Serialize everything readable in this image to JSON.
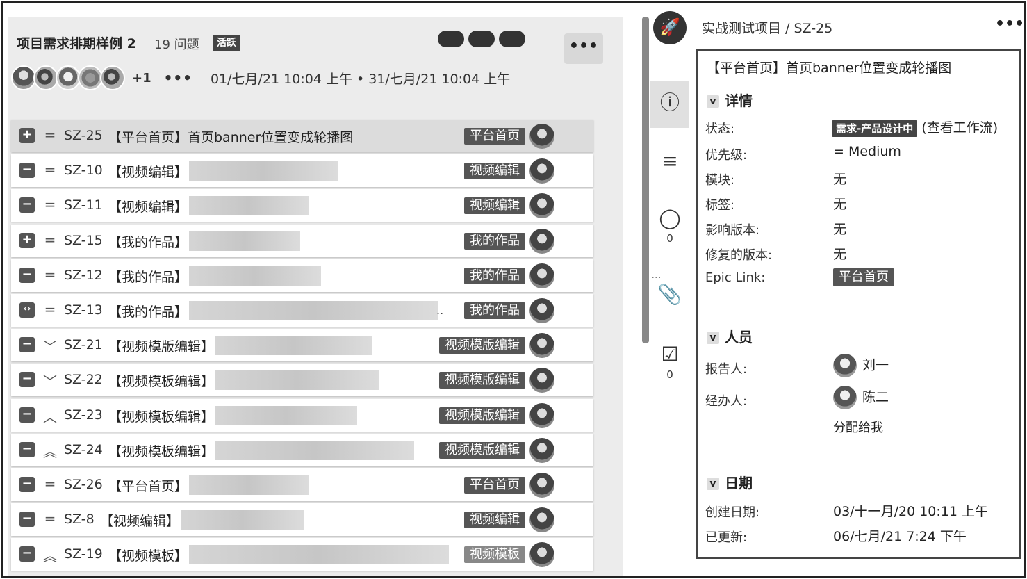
{
  "board": {
    "sprint_title": "项目需求排期样例 2",
    "issue_count": "19 问题",
    "active_label": "活跃",
    "more": "•••",
    "plus_more": "+1",
    "dots": "•••",
    "date_range": "01/七月/21 10:04 上午 • 31/七月/21 10:04 上午"
  },
  "issues": [
    {
      "key": "SZ-25",
      "type": "+",
      "priority": "=",
      "summary": "【平台首页】首页banner位置变成轮播图",
      "epic": "平台首页",
      "blur_w": 0,
      "selected": true
    },
    {
      "key": "SZ-10",
      "type": "−",
      "priority": "=",
      "summary": "【视频编辑】",
      "epic": "视频编辑",
      "blur_w": 214
    },
    {
      "key": "SZ-11",
      "type": "−",
      "priority": "=",
      "summary": "【视频编辑】",
      "epic": "视频编辑",
      "blur_w": 172
    },
    {
      "key": "SZ-15",
      "type": "+",
      "priority": "=",
      "summary": "【我的作品】",
      "epic": "我的作品",
      "blur_w": 160
    },
    {
      "key": "SZ-12",
      "type": "−",
      "priority": "=",
      "summary": "【我的作品】",
      "epic": "我的作品",
      "blur_w": 190
    },
    {
      "key": "SZ-13",
      "type": "‹›",
      "priority": "=",
      "summary": "【我的作品】",
      "epic": "我的作品",
      "blur_w": 358,
      "ellipsis": ".."
    },
    {
      "key": "SZ-21",
      "type": "−",
      "priority": "﹀",
      "summary": "【视频模版编辑】",
      "epic": "视频模版编辑",
      "blur_w": 226
    },
    {
      "key": "SZ-22",
      "type": "−",
      "priority": "﹀",
      "summary": "【视频模板编辑】",
      "epic": "视频模版编辑",
      "blur_w": 236
    },
    {
      "key": "SZ-23",
      "type": "−",
      "priority": "︿",
      "summary": "【视频模板编辑】",
      "epic": "视频模版编辑",
      "blur_w": 204
    },
    {
      "key": "SZ-24",
      "type": "−",
      "priority": "︽",
      "summary": "【视频模板编辑】",
      "epic": "视频模版编辑",
      "blur_w": 286
    },
    {
      "key": "SZ-26",
      "type": "−",
      "priority": "=",
      "summary": "【平台首页】",
      "epic": "平台首页",
      "blur_w": 172
    },
    {
      "key": "SZ-8",
      "type": "−",
      "priority": "=",
      "summary": "【视频编辑】",
      "epic": "视频编辑",
      "blur_w": 178
    },
    {
      "key": "SZ-19",
      "type": "−",
      "priority": "︽",
      "summary": "【视频模板】",
      "epic": "视频模板",
      "blur_w": 374,
      "light_epic": true
    }
  ],
  "sidebar_icons": {
    "logo": "🚀",
    "comments_count": "0",
    "checklist_count": "0"
  },
  "detail": {
    "breadcrumb": "实战测试项目 / SZ-25",
    "more": "•••",
    "title": "【平台首页】首页banner位置变成轮播图",
    "sec_details": "详情",
    "status_label": "状态:",
    "status_value": "需求-产品设计中",
    "status_link": "(查看工作流)",
    "priority_label": "优先级:",
    "priority_value": "= Medium",
    "module_label": "模块:",
    "module_value": "无",
    "tags_label": "标签:",
    "tags_value": "无",
    "affects_label": "影响版本:",
    "affects_value": "无",
    "fix_label": "修复的版本:",
    "fix_value": "无",
    "epic_label": "Epic Link:",
    "epic_value": "平台首页",
    "sec_people": "人员",
    "reporter_label": "报告人:",
    "reporter_value": "刘一",
    "assignee_label": "经办人:",
    "assignee_value": "陈二",
    "assign_me": "分配给我",
    "sec_dates": "日期",
    "created_label": "创建日期:",
    "created_value": "03/十一月/20 10:11 上午",
    "updated_label": "已更新:",
    "updated_value": "06/七月/21 7:24 下午"
  }
}
